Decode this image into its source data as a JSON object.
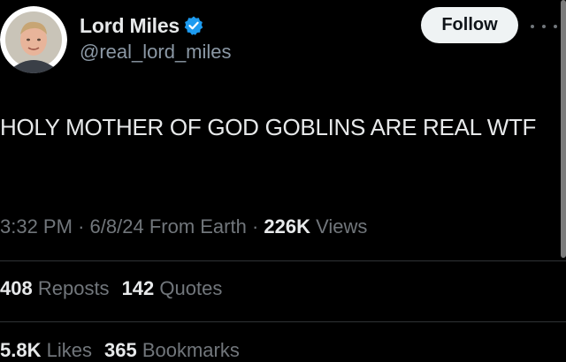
{
  "author": {
    "display_name": "Lord Miles",
    "handle": "@real_lord_miles",
    "verified": true,
    "verified_color": "#1d9bf0",
    "avatar_icon": "avatar-photo"
  },
  "actions": {
    "follow_label": "Follow",
    "more_icon": "ellipsis-icon"
  },
  "tweet": {
    "text": "HOLY MOTHER OF GOD GOBLINS ARE REAL WTF"
  },
  "meta": {
    "time": "3:32 PM",
    "separator": "·",
    "date": "6/8/24",
    "source": "From Earth",
    "views_count": "226K",
    "views_label": "Views"
  },
  "stats": {
    "reposts": {
      "count": "408",
      "label": "Reposts"
    },
    "quotes": {
      "count": "142",
      "label": "Quotes"
    },
    "likes": {
      "count": "5.8K",
      "label": "Likes"
    },
    "bookmarks": {
      "count": "365",
      "label": "Bookmarks"
    }
  },
  "colors": {
    "background": "#000000",
    "primary_text": "#e7e9ea",
    "secondary_text": "#71767b",
    "divider": "#2f3336",
    "follow_bg": "#eff3f4"
  }
}
